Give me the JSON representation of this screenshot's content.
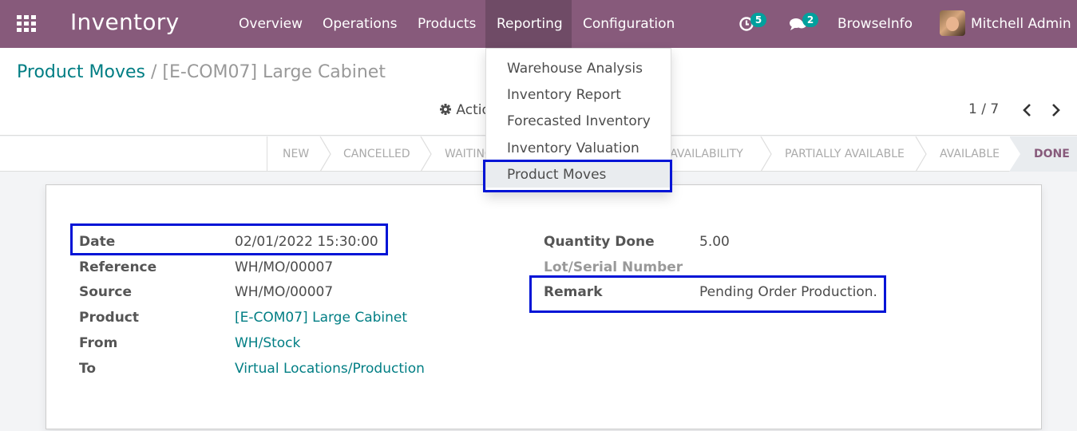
{
  "app": {
    "title": "Inventory",
    "menu": [
      "Overview",
      "Operations",
      "Products",
      "Reporting",
      "Configuration"
    ],
    "active_menu": "Reporting",
    "activity_count": "5",
    "message_count": "2",
    "company": "BrowseInfo",
    "user": "Mitchell Admin"
  },
  "breadcrumb": {
    "parent": "Product Moves",
    "separator": "/",
    "current": "[E-COM07] Large Cabinet"
  },
  "toolbar": {
    "action_label": "Action",
    "pager": "1 / 7"
  },
  "reporting_menu": {
    "items": [
      "Warehouse Analysis",
      "Inventory Report",
      "Forecasted Inventory",
      "Inventory Valuation",
      "Product Moves"
    ],
    "selected": "Product Moves"
  },
  "statusbar": {
    "stages": [
      "NEW",
      "CANCELLED",
      "WAITING ANOTHER MOVE",
      "WAITING AVAILABILITY",
      "PARTIALLY AVAILABLE",
      "AVAILABLE",
      "DONE"
    ],
    "current": "DONE"
  },
  "form": {
    "left": [
      {
        "label": "Date",
        "value": "02/01/2022 15:30:00"
      },
      {
        "label": "Reference",
        "value": "WH/MO/00007"
      },
      {
        "label": "Source",
        "value": "WH/MO/00007"
      },
      {
        "label": "Product",
        "value": "[E-COM07] Large Cabinet"
      },
      {
        "label": "From",
        "value": "WH/Stock"
      },
      {
        "label": "To",
        "value": "Virtual Locations/Production"
      }
    ],
    "right": [
      {
        "label": "Quantity Done",
        "value": "5.00"
      },
      {
        "label": "Lot/Serial Number",
        "value": ""
      },
      {
        "label": "Remark",
        "value": "Pending Order Production."
      }
    ]
  },
  "colors": {
    "navbar": "#875a7b",
    "link": "#017e84",
    "highlight": "#0014d6",
    "badge": "#00a09d"
  }
}
